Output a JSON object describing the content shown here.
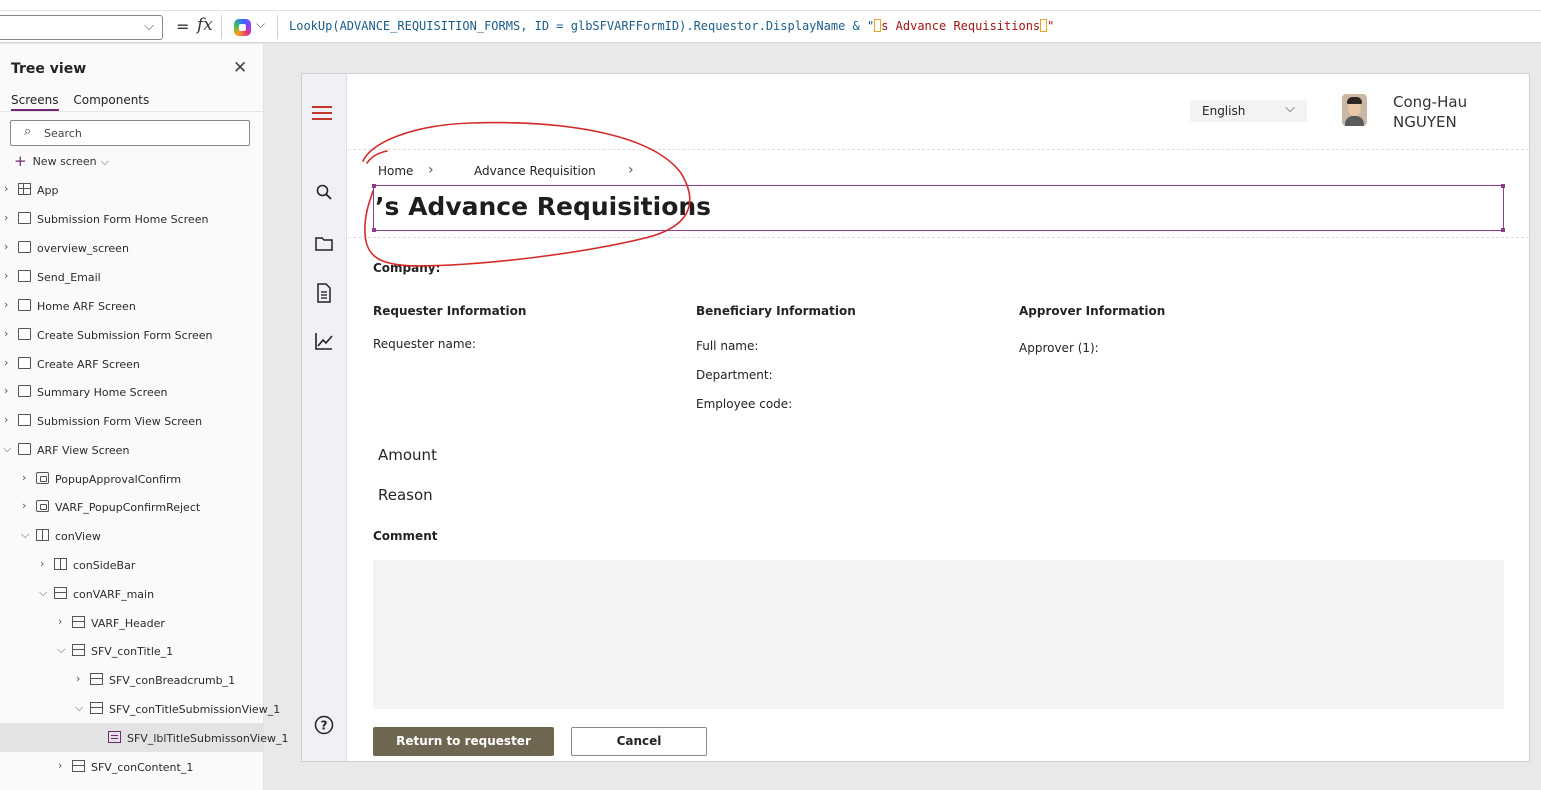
{
  "formula_bar": {
    "equals": "=",
    "fx": "fx",
    "formula_part1": "LookUp(ADVANCE_REQUISITION_FORMS, ID = glbSFVARFFormID).Requestor.DisplayName & \"",
    "formula_part2": "s Advance Requisitions",
    "formula_part3": "\""
  },
  "tree_view": {
    "title": "Tree view",
    "tabs": [
      "Screens",
      "Components"
    ],
    "search_placeholder": "Search",
    "new_screen": "New screen",
    "items": [
      {
        "label": "App"
      },
      {
        "label": "Submission Form Home Screen"
      },
      {
        "label": "overview_screen"
      },
      {
        "label": "Send_Email"
      },
      {
        "label": "Home ARF Screen"
      },
      {
        "label": "Create Submission Form Screen"
      },
      {
        "label": "Create ARF Screen"
      },
      {
        "label": "Summary Home Screen"
      },
      {
        "label": "Submission Form View Screen"
      },
      {
        "label": "ARF View Screen"
      },
      {
        "label": "PopupApprovalConfirm"
      },
      {
        "label": "VARF_PopupConfirmReject"
      },
      {
        "label": "conView"
      },
      {
        "label": "conSideBar"
      },
      {
        "label": "conVARF_main"
      },
      {
        "label": "VARF_Header"
      },
      {
        "label": "SFV_conTitle_1"
      },
      {
        "label": "SFV_conBreadcrumb_1"
      },
      {
        "label": "SFV_conTitleSubmissionView_1"
      },
      {
        "label": "SFV_lblTitleSubmissonView_1"
      },
      {
        "label": "SFV_conContent_1"
      }
    ]
  },
  "app": {
    "language": "English",
    "user_name_line1": "Cong-Hau",
    "user_name_line2": "NGUYEN",
    "breadcrumb": {
      "home": "Home",
      "sep1": "›",
      "section": "Advance Requisition",
      "sep2": "›"
    },
    "title": "’s Advance Requisitions",
    "company_label": "Company:",
    "requester": {
      "heading": "Requester Information",
      "name_label": "Requester name:"
    },
    "beneficiary": {
      "heading": "Beneficiary Information",
      "full_name_label": "Full name:",
      "department_label": "Department:",
      "employee_code_label": "Employee code:"
    },
    "approver": {
      "heading": "Approver Information",
      "approver1_label": "Approver (1):"
    },
    "amount_label": "Amount",
    "reason_label": "Reason",
    "comment_label": "Comment",
    "return_button": "Return to requester",
    "cancel_button": "Cancel"
  },
  "colors": {
    "accent": "#742774",
    "primary_button": "#6e6650",
    "annotation": "#d42a2a"
  }
}
